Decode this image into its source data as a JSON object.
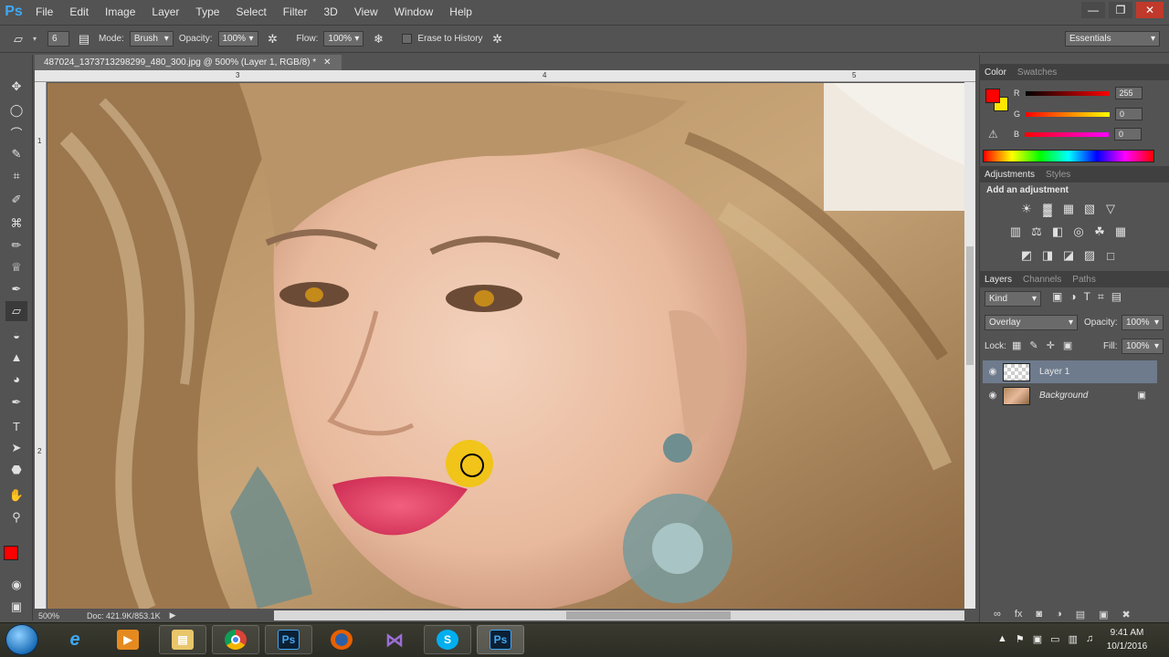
{
  "app": {
    "logo": "Ps"
  },
  "menu": [
    "File",
    "Edit",
    "Image",
    "Layer",
    "Type",
    "Select",
    "Filter",
    "3D",
    "View",
    "Window",
    "Help"
  ],
  "window_controls": [
    "minimize-icon",
    "restore-icon",
    "close-icon"
  ],
  "options": {
    "brush_size": "6",
    "mode_label": "Mode:",
    "mode_value": "Brush",
    "opacity_label": "Opacity:",
    "opacity_value": "100%",
    "flow_label": "Flow:",
    "flow_value": "100%",
    "erase_history_label": "Erase to History",
    "workspace": "Essentials"
  },
  "document": {
    "tab_title": "487024_1373713298299_480_300.jpg @ 500% (Layer 1, RGB/8) *",
    "ruler_top": [
      "3",
      "4",
      "5"
    ],
    "ruler_left": [
      "1",
      "2"
    ],
    "zoom": "500%",
    "doc_size": "Doc: 421.9K/853.1K"
  },
  "color_panel": {
    "tabs": [
      "Color",
      "Swatches"
    ],
    "foreground": "#ff0000",
    "background": "#ffe600",
    "channels": [
      {
        "label": "R",
        "value": "255"
      },
      {
        "label": "G",
        "value": "0"
      },
      {
        "label": "B",
        "value": "0"
      }
    ]
  },
  "adjustments_panel": {
    "tabs": [
      "Adjustments",
      "Styles"
    ],
    "heading": "Add an adjustment",
    "icons": [
      "brightness-icon",
      "levels-icon",
      "curves-icon",
      "exposure-icon",
      "vibrance-icon",
      "hue-saturation-icon",
      "color-balance-icon",
      "black-white-icon",
      "photo-filter-icon",
      "channel-mixer-icon",
      "color-lookup-icon",
      "invert-icon",
      "posterize-icon",
      "threshold-icon",
      "gradient-map-icon",
      "selective-color-icon"
    ]
  },
  "layers_panel": {
    "tabs": [
      "Layers",
      "Channels",
      "Paths"
    ],
    "kind": "Kind",
    "blend_mode": "Overlay",
    "opacity_label": "Opacity:",
    "opacity_value": "100%",
    "lock_label": "Lock:",
    "fill_label": "Fill:",
    "fill_value": "100%",
    "layers": [
      {
        "name": "Layer 1",
        "selected": true
      },
      {
        "name": "Background",
        "selected": false
      }
    ]
  },
  "taskbar": {
    "apps": [
      "internet-explorer-icon",
      "media-player-icon",
      "file-explorer-icon",
      "chrome-icon",
      "photoshop-icon",
      "firefox-icon",
      "visual-studio-icon",
      "skype-icon",
      "photoshop-icon"
    ],
    "ps_label": "Ps",
    "skype_label": "S",
    "time": "9:41 AM",
    "date": "10/1/2016"
  },
  "colors": {
    "accent": "#3fa9f5",
    "panel": "#535353",
    "selection": "#6e7b8d"
  }
}
